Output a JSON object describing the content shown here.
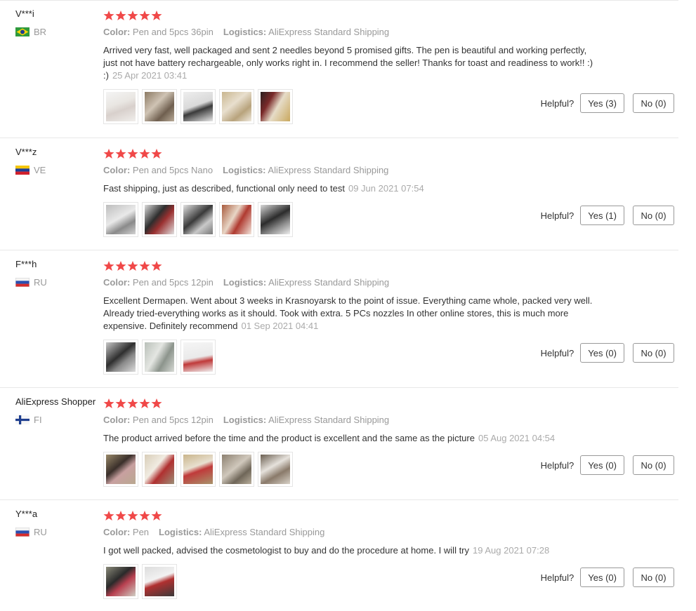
{
  "labels": {
    "color": "Color:",
    "logistics": "Logistics:",
    "helpful": "Helpful?"
  },
  "colors": {
    "star": "#f04848",
    "meta_label": "#999999",
    "date": "#aaaaaa"
  },
  "reviews": [
    {
      "user": "V***i",
      "country": "BR",
      "flag": "brazil-flag-icon",
      "rating": 5,
      "color": "Pen and 5pcs 36pin",
      "logistics": "AliExpress Standard Shipping",
      "text": "Arrived very fast, well packaged and sent 2 needles beyond 5 promised gifts. The pen is beautiful and working perfectly, just not have battery rechargeable, only works right in. I recommend the seller! Thanks for toast and readiness to work!! :) :)",
      "date": "25 Apr 2021 03:41",
      "yes": "Yes (3)",
      "no": "No (0)"
    },
    {
      "user": "V***z",
      "country": "VE",
      "flag": "venezuela-flag-icon",
      "rating": 5,
      "color": "Pen and 5pcs Nano",
      "logistics": "AliExpress Standard Shipping",
      "text": "Fast shipping, just as described, functional only need to test",
      "date": "09 Jun 2021 07:54",
      "yes": "Yes (1)",
      "no": "No (0)"
    },
    {
      "user": "F***h",
      "country": "RU",
      "flag": "russia-flag-icon",
      "rating": 5,
      "color": "Pen and 5pcs 12pin",
      "logistics": "AliExpress Standard Shipping",
      "text": "Excellent Dermapen. Went about 3 weeks in Krasnoyarsk to the point of issue. Everything came whole, packed very well. Already tried-everything works as it should. Took with extra. 5 PCs nozzles In other online stores, this is much more expensive. Definitely recommend",
      "date": "01 Sep 2021 04:41",
      "yes": "Yes (0)",
      "no": "No (0)"
    },
    {
      "user": "AliExpress Shopper",
      "country": "FI",
      "flag": "finland-flag-icon",
      "rating": 5,
      "color": "Pen and 5pcs 12pin",
      "logistics": "AliExpress Standard Shipping",
      "text": "The product arrived before the time and the product is excellent and the same as the picture",
      "date": "05 Aug 2021 04:54",
      "yes": "Yes (0)",
      "no": "No (0)"
    },
    {
      "user": "Y***a",
      "country": "RU",
      "flag": "russia-flag-icon",
      "rating": 5,
      "color": "Pen",
      "logistics": "AliExpress Standard Shipping",
      "text": "I got well packed, advised the cosmetologist to buy and do the procedure at home. I will try",
      "date": "19 Aug 2021 07:28",
      "yes": "Yes (0)",
      "no": "No (0)"
    }
  ]
}
